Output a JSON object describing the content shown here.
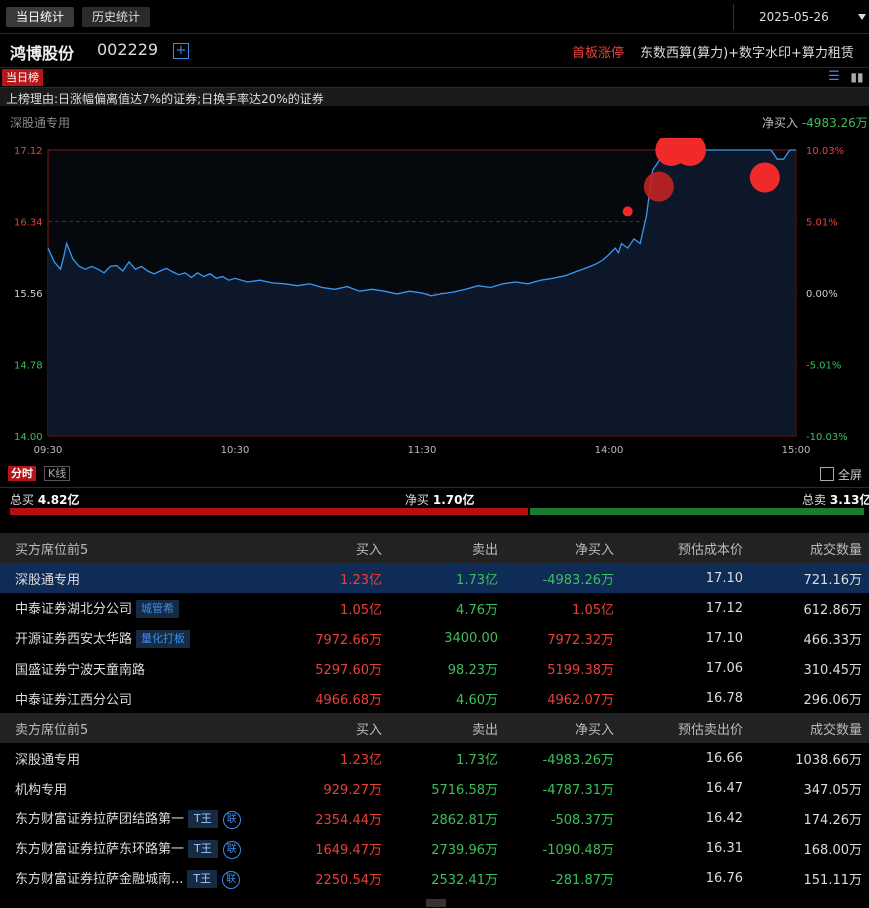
{
  "tabs": [
    "当日统计",
    "历史统计"
  ],
  "date": "2025-05-26",
  "stock": {
    "name": "鸿博股份",
    "code": "002229",
    "plus": "+",
    "limit_tag": "首板涨停",
    "concepts": "东数西算(算力)+数字水印+算力租赁"
  },
  "section_tab": "当日榜",
  "reason": "上榜理由:日涨幅偏离值达7%的证券;日换手率达20%的证券",
  "chart_label": "深股通专用",
  "net_buy_label": "净买入",
  "net_buy_value": "-4983.26万",
  "chart_data": {
    "type": "line",
    "title": "",
    "prev_close": 15.56,
    "ylim": [
      14.0,
      17.12
    ],
    "y_ticks_left": [
      "17.12",
      "16.34",
      "15.56",
      "14.78",
      "14.00"
    ],
    "y_ticks_right": [
      "10.03%",
      "5.01%",
      "0.00%",
      "-5.01%",
      "-10.03%"
    ],
    "x_ticks": [
      "09:30",
      "10:30",
      "11:30",
      "14:00",
      "15:00"
    ],
    "x_minutes": [
      0,
      240
    ],
    "series": [
      {
        "x": [
          0,
          2,
          4,
          5,
          6,
          8,
          10,
          12,
          14,
          16,
          18,
          20,
          22,
          24,
          26,
          28,
          30,
          32,
          34,
          36,
          38,
          40,
          42,
          44,
          46,
          48,
          50,
          52,
          54,
          56,
          58,
          60,
          64,
          68,
          72,
          76,
          80,
          84,
          88,
          92,
          96,
          100,
          104,
          108,
          112,
          116,
          120,
          123,
          126,
          130,
          134,
          138,
          142,
          146,
          150,
          154,
          158,
          162,
          166,
          170,
          174,
          176,
          178,
          180,
          182,
          183,
          184,
          186,
          188,
          190,
          192,
          194,
          198,
          200,
          202,
          204,
          206,
          208,
          210,
          214,
          218,
          222,
          226,
          230,
          232,
          234,
          236,
          238,
          240
        ],
        "y": [
          16.05,
          15.9,
          15.82,
          15.95,
          16.1,
          15.93,
          15.85,
          15.82,
          15.85,
          15.82,
          15.78,
          15.85,
          15.86,
          15.8,
          15.9,
          15.82,
          15.85,
          15.8,
          15.77,
          15.8,
          15.83,
          15.79,
          15.76,
          15.78,
          15.73,
          15.78,
          15.74,
          15.77,
          15.72,
          15.74,
          15.7,
          15.72,
          15.68,
          15.7,
          15.67,
          15.66,
          15.64,
          15.66,
          15.62,
          15.6,
          15.63,
          15.58,
          15.6,
          15.58,
          15.55,
          15.58,
          15.56,
          15.53,
          15.55,
          15.57,
          15.6,
          15.64,
          15.62,
          15.66,
          15.68,
          15.66,
          15.7,
          15.72,
          15.75,
          15.8,
          15.85,
          15.88,
          15.92,
          15.98,
          16.05,
          16.0,
          16.1,
          16.05,
          16.15,
          16.1,
          16.4,
          16.9,
          17.1,
          17.12,
          17.12,
          17.12,
          17.12,
          17.12,
          17.12,
          17.12,
          17.12,
          17.12,
          17.12,
          17.12,
          17.12,
          17.02,
          17.02,
          17.12,
          17.12
        ]
      }
    ],
    "markers": [
      {
        "x": 186,
        "y": 16.45
      },
      {
        "x": 196,
        "y": 16.72
      },
      {
        "x": 200,
        "y": 17.12
      },
      {
        "x": 206,
        "y": 17.12
      },
      {
        "x": 230,
        "y": 16.82
      }
    ]
  },
  "view_tabs": [
    "分时",
    "K线"
  ],
  "fullscreen_label": "全屏",
  "totals": {
    "buy_label": "总买",
    "buy": "4.82亿",
    "net_label": "净买",
    "net": "1.70亿",
    "sell_label": "总卖",
    "sell": "3.13亿",
    "buy_fraction": 0.606
  },
  "buy_table": {
    "headers": [
      "买方席位前5",
      "买入",
      "卖出",
      "净买入",
      "预估成本价",
      "成交数量"
    ],
    "rows": [
      {
        "name": "深股通专用",
        "tag": "",
        "buy": "1.23亿",
        "sell": "1.73亿",
        "net": "-4983.26万",
        "price": "17.10",
        "vol": "721.16万"
      },
      {
        "name": "中泰证券湖北分公司",
        "tag": "城管希",
        "buy": "1.05亿",
        "sell": "4.76万",
        "net": "1.05亿",
        "price": "17.12",
        "vol": "612.86万"
      },
      {
        "name": "开源证券西安太华路",
        "tag": "量化打板",
        "buy": "7972.66万",
        "sell": "3400.00",
        "net": "7972.32万",
        "price": "17.10",
        "vol": "466.33万"
      },
      {
        "name": "国盛证券宁波天童南路",
        "tag": "",
        "buy": "5297.60万",
        "sell": "98.23万",
        "net": "5199.38万",
        "price": "17.06",
        "vol": "310.45万"
      },
      {
        "name": "中泰证券江西分公司",
        "tag": "",
        "buy": "4966.68万",
        "sell": "4.60万",
        "net": "4962.07万",
        "price": "16.78",
        "vol": "296.06万"
      }
    ]
  },
  "sell_table": {
    "headers": [
      "卖方席位前5",
      "买入",
      "卖出",
      "净买入",
      "预估卖出价",
      "成交数量"
    ],
    "rows": [
      {
        "name": "深股通专用",
        "tag": "",
        "lian": "",
        "buy": "1.23亿",
        "sell": "1.73亿",
        "net": "-4983.26万",
        "price": "16.66",
        "vol": "1038.66万"
      },
      {
        "name": "机构专用",
        "tag": "",
        "lian": "",
        "buy": "929.27万",
        "sell": "5716.58万",
        "net": "-4787.31万",
        "price": "16.47",
        "vol": "347.05万"
      },
      {
        "name": "东方财富证券拉萨团结路第一",
        "tag": "T王",
        "lian": "联",
        "buy": "2354.44万",
        "sell": "2862.81万",
        "net": "-508.37万",
        "price": "16.42",
        "vol": "174.26万"
      },
      {
        "name": "东方财富证券拉萨东环路第一",
        "tag": "T王",
        "lian": "联",
        "buy": "1649.47万",
        "sell": "2739.96万",
        "net": "-1090.48万",
        "price": "16.31",
        "vol": "168.00万"
      },
      {
        "name": "东方财富证券拉萨金融城南...",
        "tag": "T王",
        "lian": "联",
        "buy": "2250.54万",
        "sell": "2532.41万",
        "net": "-281.87万",
        "price": "16.76",
        "vol": "151.11万"
      }
    ]
  },
  "colors": {
    "up": "#e8403a",
    "down": "#3cbf5c",
    "line": "#3a97f0",
    "selected_row": "#0f2c56"
  }
}
